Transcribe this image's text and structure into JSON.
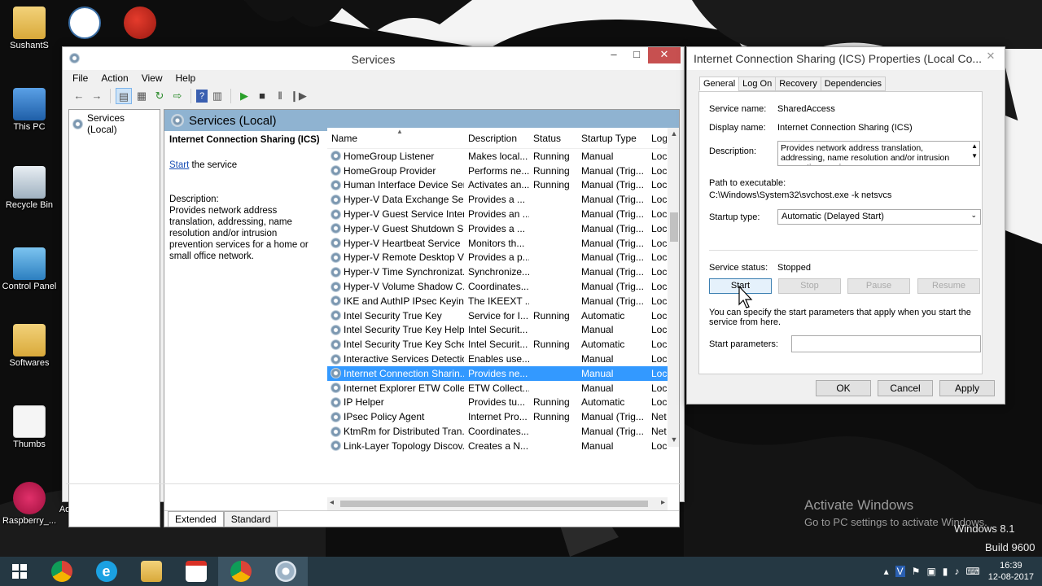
{
  "desktop": {
    "icons": [
      {
        "label": "SushantS"
      },
      {
        "label": "This PC"
      },
      {
        "label": "Recycle Bin"
      },
      {
        "label": "Control Panel"
      },
      {
        "label": "Softwares"
      },
      {
        "label": "Thumbs"
      },
      {
        "label": "Raspberry_..."
      },
      {
        "label": "Advanced IP Scanner"
      }
    ],
    "watermark": {
      "line1": "Activate Windows",
      "line2": "Go to PC settings to activate Windows.",
      "edition": "Windows 8.1",
      "build": "Build 9600"
    }
  },
  "services_window": {
    "title": "Services",
    "menu": [
      "File",
      "Action",
      "View",
      "Help"
    ],
    "tree_root": "Services (Local)",
    "header": "Services (Local)",
    "selected_service_title": "Internet Connection Sharing (ICS)",
    "start_link": "Start",
    "start_link_suffix": " the service",
    "description_label": "Description:",
    "description_text": "Provides network address translation, addressing, name resolution and/or intrusion prevention services for a home or small office network.",
    "columns": [
      "Name",
      "Description",
      "Status",
      "Startup Type",
      "Log"
    ],
    "rows": [
      {
        "name": "HomeGroup Listener",
        "desc": "Makes local...",
        "status": "Running",
        "startup": "Manual",
        "log": "Loc"
      },
      {
        "name": "HomeGroup Provider",
        "desc": "Performs ne...",
        "status": "Running",
        "startup": "Manual (Trig...",
        "log": "Loc"
      },
      {
        "name": "Human Interface Device Ser...",
        "desc": "Activates an...",
        "status": "Running",
        "startup": "Manual (Trig...",
        "log": "Loc"
      },
      {
        "name": "Hyper-V Data Exchange Ser...",
        "desc": "Provides a ...",
        "status": "",
        "startup": "Manual (Trig...",
        "log": "Loc"
      },
      {
        "name": "Hyper-V Guest Service Inter...",
        "desc": "Provides an ...",
        "status": "",
        "startup": "Manual (Trig...",
        "log": "Loc"
      },
      {
        "name": "Hyper-V Guest Shutdown S...",
        "desc": "Provides a ...",
        "status": "",
        "startup": "Manual (Trig...",
        "log": "Loc"
      },
      {
        "name": "Hyper-V Heartbeat Service",
        "desc": "Monitors th...",
        "status": "",
        "startup": "Manual (Trig...",
        "log": "Loc"
      },
      {
        "name": "Hyper-V Remote Desktop Vi...",
        "desc": "Provides a p...",
        "status": "",
        "startup": "Manual (Trig...",
        "log": "Loc"
      },
      {
        "name": "Hyper-V Time Synchronizat...",
        "desc": "Synchronize...",
        "status": "",
        "startup": "Manual (Trig...",
        "log": "Loc"
      },
      {
        "name": "Hyper-V Volume Shadow C...",
        "desc": "Coordinates...",
        "status": "",
        "startup": "Manual (Trig...",
        "log": "Loc"
      },
      {
        "name": "IKE and AuthIP IPsec Keying...",
        "desc": "The IKEEXT ...",
        "status": "",
        "startup": "Manual (Trig...",
        "log": "Loc"
      },
      {
        "name": "Intel Security True Key",
        "desc": "Service for I...",
        "status": "Running",
        "startup": "Automatic",
        "log": "Loc"
      },
      {
        "name": "Intel Security True Key Help...",
        "desc": "Intel Securit...",
        "status": "",
        "startup": "Manual",
        "log": "Loc"
      },
      {
        "name": "Intel Security True Key Sche...",
        "desc": "Intel Securit...",
        "status": "Running",
        "startup": "Automatic",
        "log": "Loc"
      },
      {
        "name": "Interactive Services Detection",
        "desc": "Enables use...",
        "status": "",
        "startup": "Manual",
        "log": "Loc"
      },
      {
        "name": "Internet Connection Sharin...",
        "desc": "Provides ne...",
        "status": "",
        "startup": "Manual",
        "log": "Loc"
      },
      {
        "name": "Internet Explorer ETW Colle...",
        "desc": "ETW Collect...",
        "status": "",
        "startup": "Manual",
        "log": "Loc"
      },
      {
        "name": "IP Helper",
        "desc": "Provides tu...",
        "status": "Running",
        "startup": "Automatic",
        "log": "Loc"
      },
      {
        "name": "IPsec Policy Agent",
        "desc": "Internet Pro...",
        "status": "Running",
        "startup": "Manual (Trig...",
        "log": "Net"
      },
      {
        "name": "KtmRm for Distributed Tran...",
        "desc": "Coordinates...",
        "status": "",
        "startup": "Manual (Trig...",
        "log": "Net"
      },
      {
        "name": "Link-Layer Topology Discov...",
        "desc": "Creates a N...",
        "status": "",
        "startup": "Manual",
        "log": "Loc"
      }
    ],
    "selected_row_index": 15,
    "tabs": [
      "Extended",
      "Standard"
    ]
  },
  "properties_dialog": {
    "title": "Internet Connection Sharing (ICS) Properties (Local Co...",
    "tabs": [
      "General",
      "Log On",
      "Recovery",
      "Dependencies"
    ],
    "service_name_label": "Service name:",
    "service_name": "SharedAccess",
    "display_name_label": "Display name:",
    "display_name": "Internet Connection Sharing (ICS)",
    "description_label": "Description:",
    "description": "Provides network address translation, addressing, name resolution and/or intrusion prevention services",
    "path_label": "Path to executable:",
    "path": "C:\\Windows\\System32\\svchost.exe -k netsvcs",
    "startup_type_label": "Startup type:",
    "startup_type": "Automatic (Delayed Start)",
    "service_status_label": "Service status:",
    "service_status": "Stopped",
    "buttons": {
      "start": "Start",
      "stop": "Stop",
      "pause": "Pause",
      "resume": "Resume"
    },
    "hint": "You can specify the start parameters that apply when you start the service from here.",
    "start_params_label": "Start parameters:",
    "ok": "OK",
    "cancel": "Cancel",
    "apply": "Apply"
  },
  "taskbar": {
    "apps": [
      "start-button",
      "chrome",
      "internet-explorer",
      "file-explorer",
      "gmail",
      "chrome-window",
      "services"
    ],
    "time": "16:39",
    "date": "12-08-2017"
  }
}
